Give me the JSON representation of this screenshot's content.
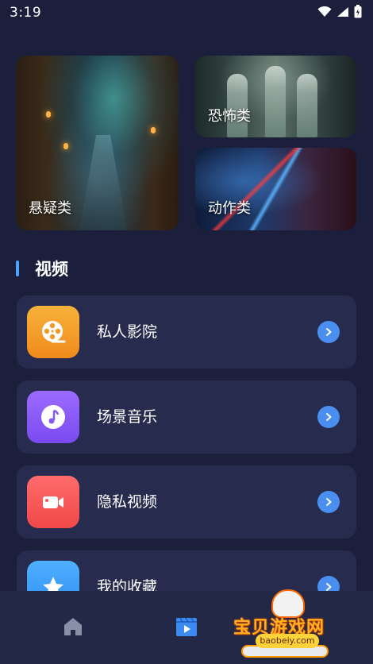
{
  "status_bar": {
    "time": "3:19",
    "icons": [
      "wifi-icon",
      "signal-icon",
      "battery-icon"
    ]
  },
  "categories": [
    {
      "id": "mystery",
      "label": "悬疑类"
    },
    {
      "id": "horror",
      "label": "恐怖类"
    },
    {
      "id": "action",
      "label": "动作类"
    }
  ],
  "section": {
    "title": "视频",
    "accent": "#4ea3ff"
  },
  "list": [
    {
      "label": "私人影院",
      "icon": "film-reel-icon",
      "color_from": "#f7b23b",
      "color_to": "#f08a1c"
    },
    {
      "label": "场景音乐",
      "icon": "music-note-icon",
      "color_from": "#9b6bff",
      "color_to": "#7a4af0"
    },
    {
      "label": "隐私视频",
      "icon": "video-camera-icon",
      "color_from": "#ff6b6b",
      "color_to": "#f04848"
    },
    {
      "label": "我的收藏",
      "icon": "star-icon",
      "color_from": "#4fb0ff",
      "color_to": "#2f8cf0"
    }
  ],
  "bottom_nav": {
    "items": [
      {
        "icon": "home-icon",
        "active": false
      },
      {
        "icon": "video-play-icon",
        "active": true
      }
    ]
  },
  "watermark": {
    "text": "宝贝游戏网",
    "url": "baobeiy.com"
  },
  "colors": {
    "background": "#1b1f3b",
    "card": "#272c4e",
    "arrow": "#4a8ff0",
    "nav_inactive": "#8a8fa8",
    "nav_active": "#3d8bf0"
  }
}
